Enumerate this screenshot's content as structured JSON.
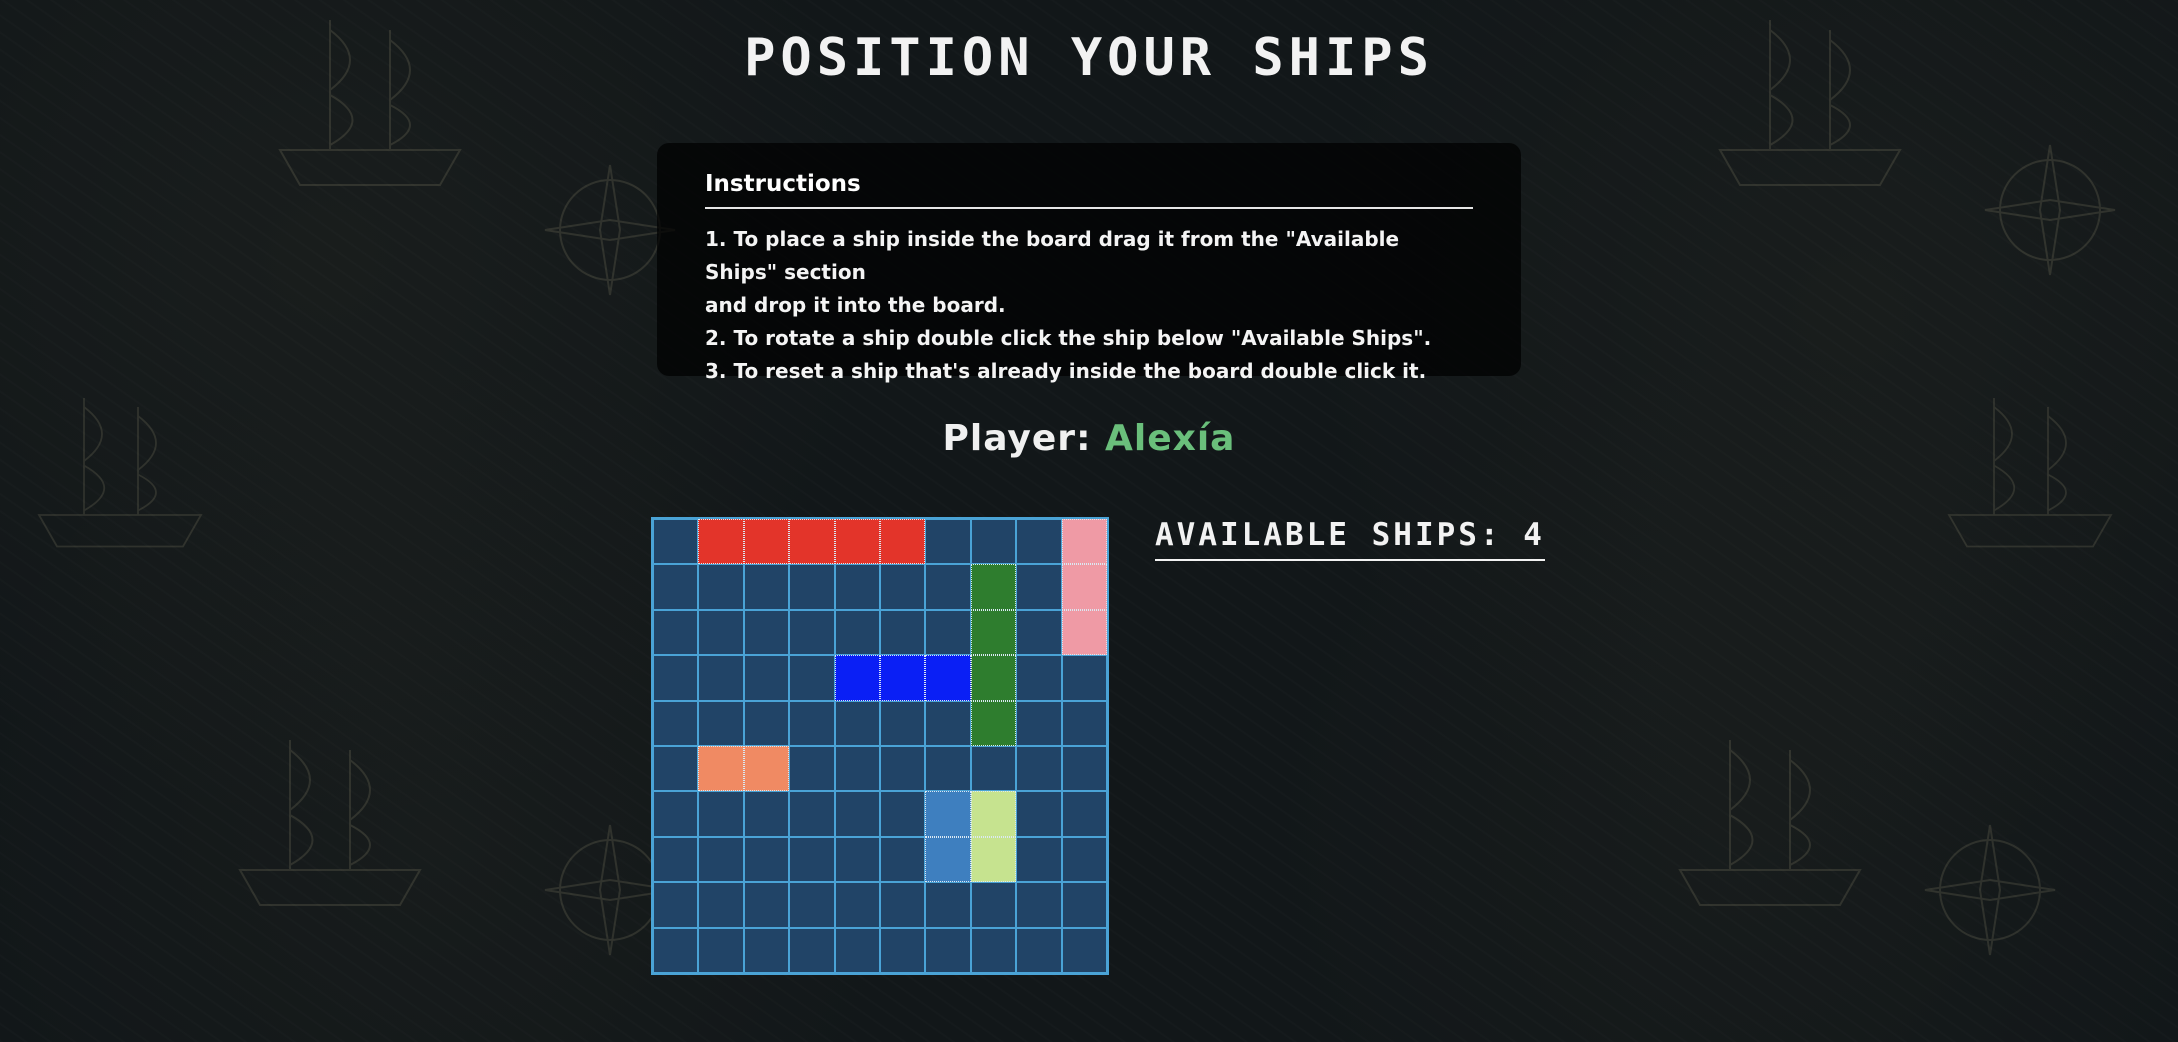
{
  "title": "POSITION YOUR SHIPS",
  "instructions": {
    "heading": "Instructions",
    "lines": [
      "1. To place a ship inside the board drag it from the \"Available Ships\" section",
      "and drop it into the board.",
      "2. To rotate a ship double click the ship below \"Available Ships\".",
      "3. To reset a ship that's already inside the board double click it."
    ]
  },
  "player": {
    "label": "Player: ",
    "name": "Alexía",
    "name_color": "#6abf7b"
  },
  "available_ships": {
    "label": "AVAILABLE SHIPS: 4"
  },
  "board": {
    "rows": 10,
    "cols": 10,
    "water_color": "#214467",
    "grid_color": "#4aa3d6",
    "ships": [
      {
        "name": "red-ship",
        "color": "#e3342a",
        "cells": [
          [
            0,
            1
          ],
          [
            0,
            2
          ],
          [
            0,
            3
          ],
          [
            0,
            4
          ],
          [
            0,
            5
          ]
        ]
      },
      {
        "name": "pink-ship",
        "color": "#ef9aa5",
        "cells": [
          [
            0,
            9
          ],
          [
            1,
            9
          ],
          [
            2,
            9
          ]
        ]
      },
      {
        "name": "green-ship",
        "color": "#2e7d2e",
        "cells": [
          [
            1,
            7
          ],
          [
            2,
            7
          ],
          [
            3,
            7
          ],
          [
            4,
            7
          ]
        ]
      },
      {
        "name": "blue-ship",
        "color": "#0a1ff5",
        "cells": [
          [
            3,
            4
          ],
          [
            3,
            5
          ],
          [
            3,
            6
          ]
        ]
      },
      {
        "name": "orange-ship",
        "color": "#f08a63",
        "cells": [
          [
            5,
            1
          ],
          [
            5,
            2
          ]
        ]
      },
      {
        "name": "steel-ship",
        "color": "#3e7fbf",
        "cells": [
          [
            6,
            6
          ],
          [
            7,
            6
          ]
        ]
      },
      {
        "name": "lime-ship",
        "color": "#c6e38f",
        "cells": [
          [
            6,
            7
          ],
          [
            7,
            7
          ]
        ]
      }
    ]
  }
}
